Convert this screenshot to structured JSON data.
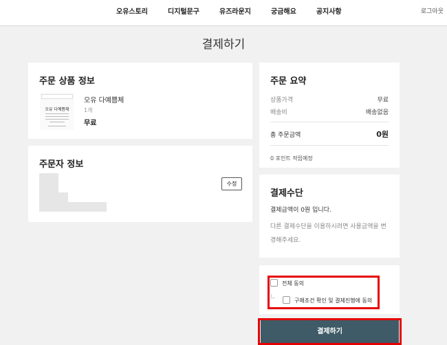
{
  "nav": {
    "items": [
      "오유스토리",
      "디지털문구",
      "유즈라운지",
      "궁금해요",
      "공지사항"
    ],
    "logout": "로그아웃"
  },
  "page_title": "결제하기",
  "order_product": {
    "title": "주문 상품 정보",
    "thumb_title": "오유 다예쁨체",
    "name": "오유 다예쁨체",
    "qty": "1개",
    "price": "무료"
  },
  "orderer": {
    "title": "주문자 정보",
    "edit_label": "수정"
  },
  "summary": {
    "title": "주문 요약",
    "rows": [
      {
        "label": "상품가격",
        "value": "무료"
      },
      {
        "label": "배송비",
        "value": "배송없음"
      }
    ],
    "total_label": "총 주문금액",
    "total_value": "0원",
    "points": "0 포인트 적립예정"
  },
  "payment": {
    "title": "결제수단",
    "line1": "결제금액이 0원 입니다.",
    "line2": "다른 결제수단을 이용하시려면 사용금액을 변경해주세요."
  },
  "agree": {
    "all": "전체 동의",
    "purchase": "구매조건 확인 및 결제진행에 동의"
  },
  "pay_button": "결제하기",
  "colors": {
    "accent_red": "#e60000",
    "pay_button": "#3f5b67",
    "background": "#f1f1f1"
  }
}
